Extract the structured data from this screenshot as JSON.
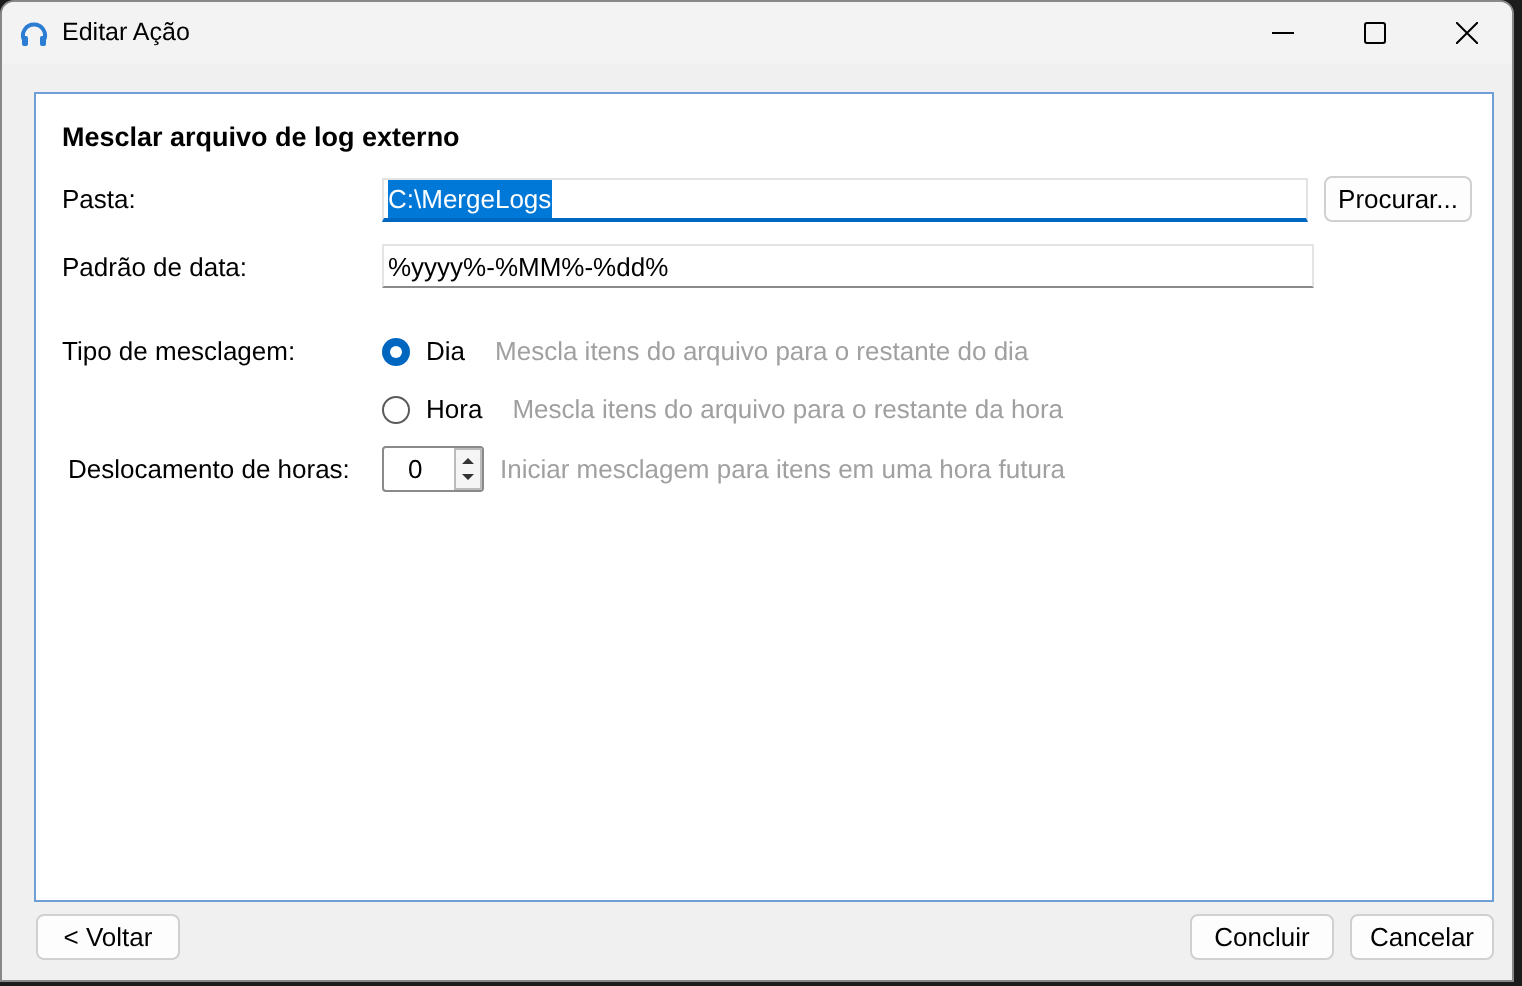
{
  "window": {
    "title": "Editar Ação"
  },
  "heading": "Mesclar arquivo de log externo",
  "fields": [
    {
      "label": "Pasta:",
      "value": "C:\\MergeLogs",
      "focused": true,
      "button": "Procurar..."
    },
    {
      "label": "Padrão de data:",
      "value": "%yyyy%-%MM%-%dd%",
      "focused": false
    }
  ],
  "merge_type": {
    "label": "Tipo de mesclagem:",
    "options": [
      {
        "label": "Dia",
        "description": "Mescla itens do arquivo para o restante do dia",
        "selected": true
      },
      {
        "label": "Hora",
        "description": "Mescla itens do arquivo para o restante da hora",
        "selected": false
      }
    ]
  },
  "hour_offset": {
    "label": "Deslocamento de horas:",
    "value": "0",
    "description": "Iniciar mesclagem para itens em uma hora futura"
  },
  "buttons": [
    {
      "label": "< Voltar",
      "kind": "left"
    },
    {
      "label": "Concluir",
      "kind": "right"
    },
    {
      "label": "Cancelar",
      "kind": "right"
    }
  ]
}
